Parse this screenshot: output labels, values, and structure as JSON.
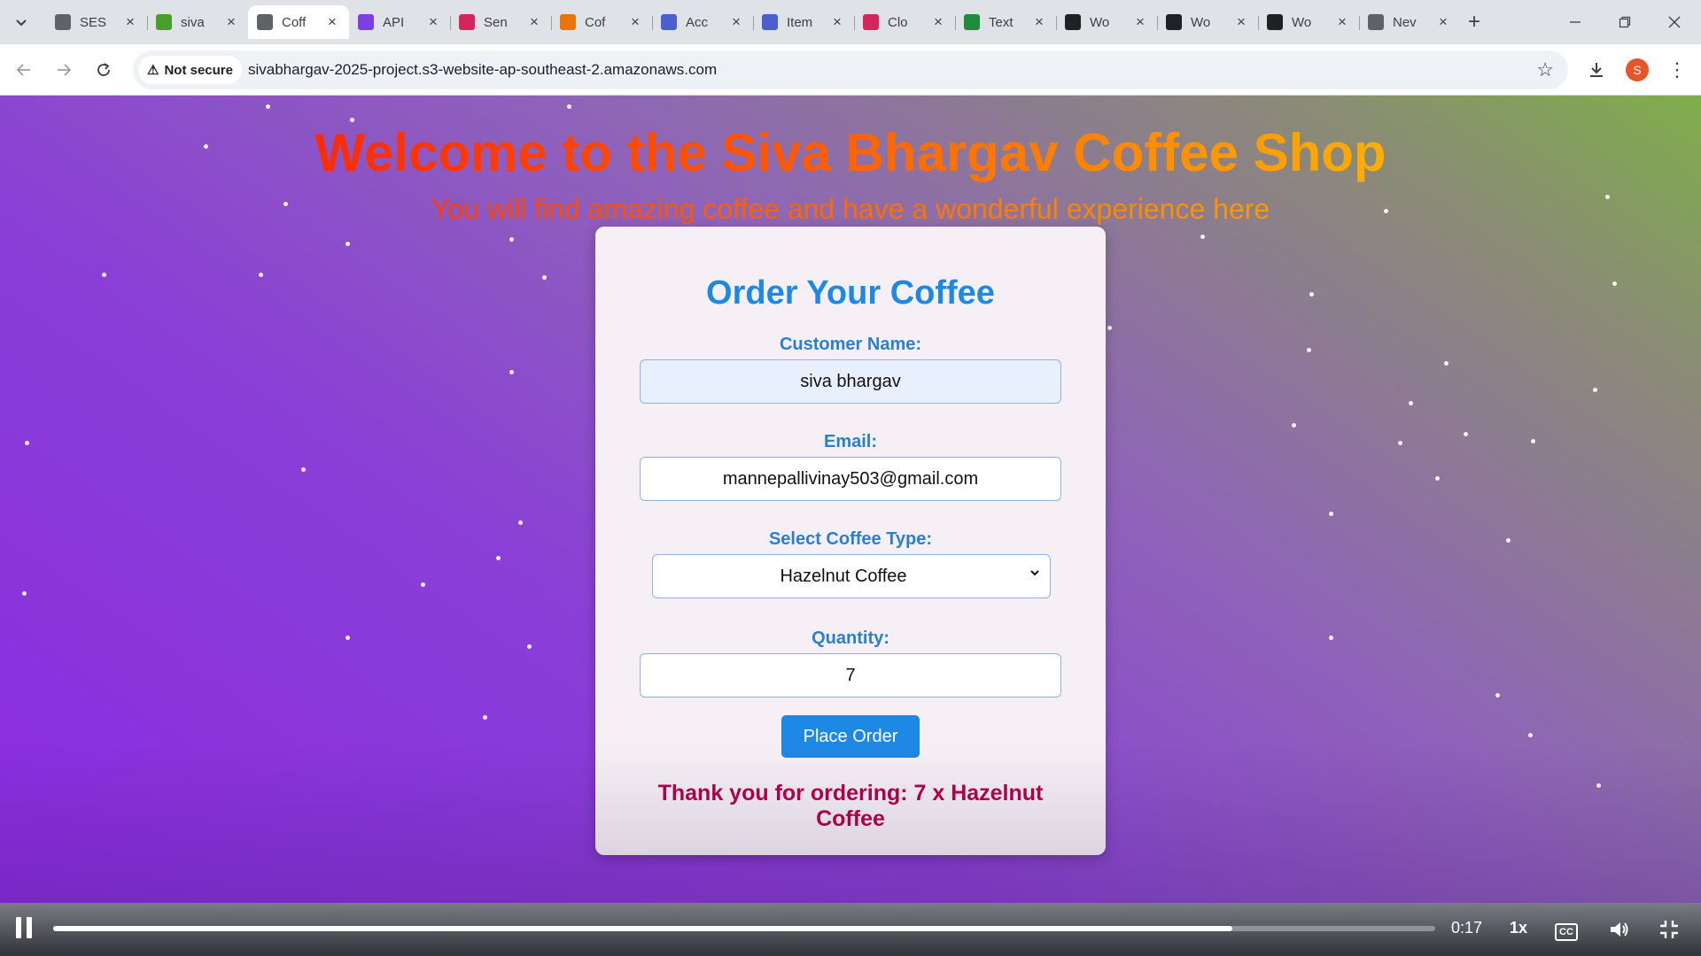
{
  "browser": {
    "tabs": [
      {
        "title": "SES",
        "icon": "gear-favicon-icon",
        "color": "#5f6368"
      },
      {
        "title": "siva",
        "icon": "sheet-favicon-icon",
        "color": "#4a9e2a"
      },
      {
        "title": "Coff",
        "icon": "globe-favicon-icon",
        "color": "#5f6368",
        "active": true
      },
      {
        "title": "API",
        "icon": "api-favicon-icon",
        "color": "#7b3fe4"
      },
      {
        "title": "Sen",
        "icon": "sns-favicon-icon",
        "color": "#d6245d"
      },
      {
        "title": "Cof",
        "icon": "lambda-favicon-icon",
        "color": "#e8740c"
      },
      {
        "title": "Acc",
        "icon": "iam-favicon-icon",
        "color": "#4b5fd1"
      },
      {
        "title": "Item",
        "icon": "dynamodb-favicon-icon",
        "color": "#4b5fd1"
      },
      {
        "title": "Clo",
        "icon": "cloudwatch-favicon-icon",
        "color": "#d6245d"
      },
      {
        "title": "Text",
        "icon": "sheet-favicon-icon",
        "color": "#1e8e3e"
      },
      {
        "title": "Wo",
        "icon": "w-favicon-icon",
        "color": "#202124"
      },
      {
        "title": "Wo",
        "icon": "w-favicon-icon",
        "color": "#202124"
      },
      {
        "title": "Wo",
        "icon": "w-favicon-icon",
        "color": "#202124"
      },
      {
        "title": "Nev",
        "icon": "globe-favicon-icon",
        "color": "#5f6368"
      }
    ],
    "security_label": "Not secure",
    "url": "sivabhargav-2025-project.s3-website-ap-southeast-2.amazonaws.com",
    "profile_initial": "S",
    "profile_color": "#e8552a"
  },
  "page": {
    "hero_title": "Welcome to the Siva Bhargav Coffee Shop",
    "hero_subtitle": "You will find amazing coffee and have a wonderful experience here",
    "form": {
      "title": "Order Your Coffee",
      "name_label": "Customer Name:",
      "name_value": "siva bhargav",
      "email_label": "Email:",
      "email_value": "mannepallivinay503@gmail.com",
      "coffee_label": "Select Coffee Type:",
      "coffee_value": "Hazelnut Coffee",
      "quantity_label": "Quantity:",
      "quantity_value": "7",
      "submit_label": "Place Order",
      "confirmation": "Thank you for ordering: 7 x Hazelnut Coffee"
    },
    "colors": {
      "accent": "#1e88e5",
      "confirmation": "#b3004b",
      "title_start": "#ff2a00",
      "title_end": "#ffb000"
    }
  },
  "player": {
    "time": "0:17",
    "speed": "1x",
    "progress_fraction": 0.853
  }
}
